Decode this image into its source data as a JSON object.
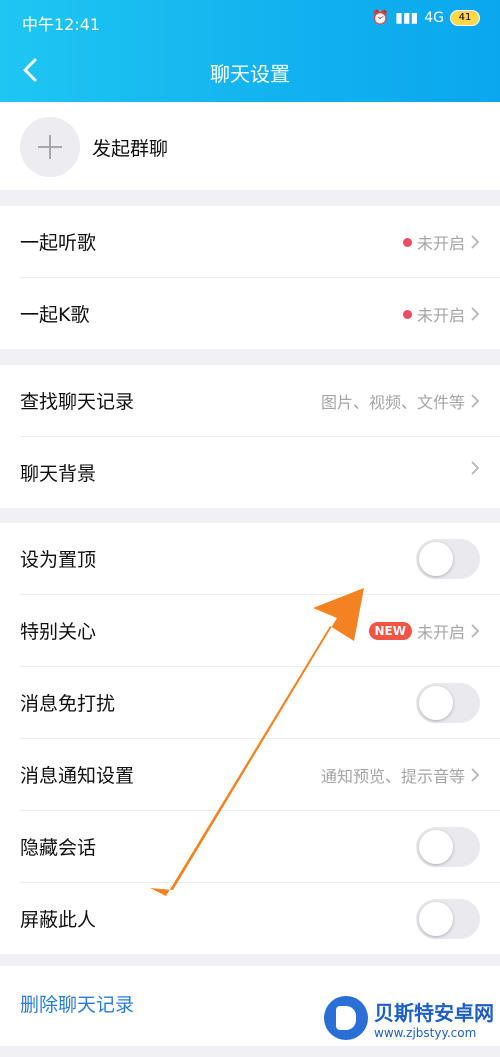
{
  "status_bar": {
    "time": "中午12:41",
    "network": "4G",
    "battery": "41"
  },
  "header": {
    "title": "聊天设置"
  },
  "group_chat": {
    "label": "发起群聊"
  },
  "music_group": [
    {
      "label": "一起听歌",
      "status": "未开启"
    },
    {
      "label": "一起K歌",
      "status": "未开启"
    }
  ],
  "records_group": [
    {
      "label": "查找聊天记录",
      "hint": "图片、视频、文件等"
    },
    {
      "label": "聊天背景"
    }
  ],
  "settings_group": [
    {
      "label": "设为置顶",
      "toggle": false
    },
    {
      "label": "特别关心",
      "badge": "NEW",
      "status": "未开启"
    },
    {
      "label": "消息免打扰",
      "toggle": false
    },
    {
      "label": "消息通知设置",
      "hint": "通知预览、提示音等"
    },
    {
      "label": "隐藏会话",
      "toggle": false
    },
    {
      "label": "屏蔽此人",
      "toggle": false
    }
  ],
  "delete": {
    "label": "删除聊天记录"
  },
  "watermark": {
    "name": "贝斯特安卓网",
    "url": "www.zjbstyy.com"
  },
  "colors": {
    "header": "#12b3ef",
    "arrow": "#f58220",
    "link": "#2b7cd9"
  }
}
